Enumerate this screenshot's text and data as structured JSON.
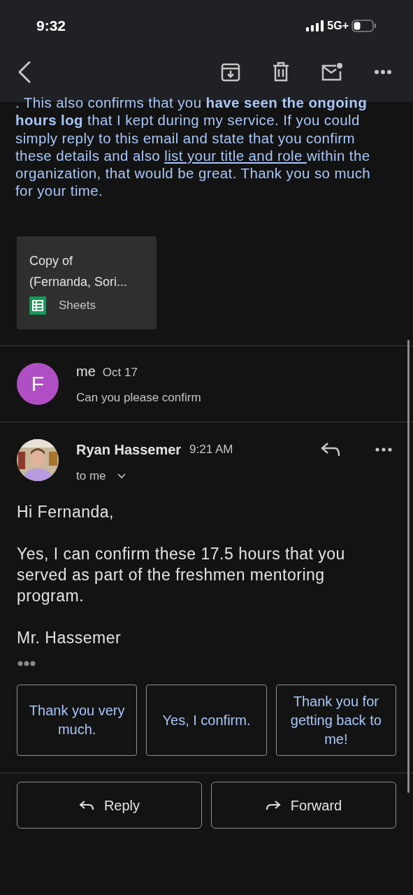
{
  "status_bar": {
    "time": "9:32",
    "network": "5G+"
  },
  "toolbar": {
    "actions": [
      {
        "kind": "back"
      },
      {
        "kind": "archive"
      },
      {
        "kind": "delete"
      },
      {
        "kind": "mark_unread"
      },
      {
        "kind": "more"
      }
    ]
  },
  "first_message": {
    "body_before": ". This also confirms that you **have seen the ongoing hours log** that I kept during my service. If you could simply reply to this email and state that you confirm these details and also ",
    "body_underlined": "list your title and role ",
    "body_after": "within the organization, that would be great.  Thank you so much for your time.",
    "attachment": {
      "title_lines": [
        "Copy of",
        "(Fernanda, Sori..."
      ],
      "app": "Sheets"
    }
  },
  "collapsed_message": {
    "avatar_letter": "F",
    "color": "#b04fc4",
    "sender": "me",
    "date": "Oct 17",
    "snippet": "Can you please confirm"
  },
  "expanded_message": {
    "sender": "Ryan Hassemer",
    "time": "9:21 AM",
    "recipient": "to me",
    "paragraphs": [
      "Hi Fernanda,",
      "Yes, I can confirm these 17.5 hours that you served as part of the freshmen mentoring program.",
      "Mr. Hassemer"
    ],
    "smart_replies": [
      "Thank you very much.",
      "Yes, I confirm.",
      "Thank you for getting back to me!"
    ]
  },
  "bottom_actions": [
    {
      "kind": "reply",
      "label": "Reply"
    },
    {
      "kind": "forward",
      "label": "Forward"
    }
  ]
}
